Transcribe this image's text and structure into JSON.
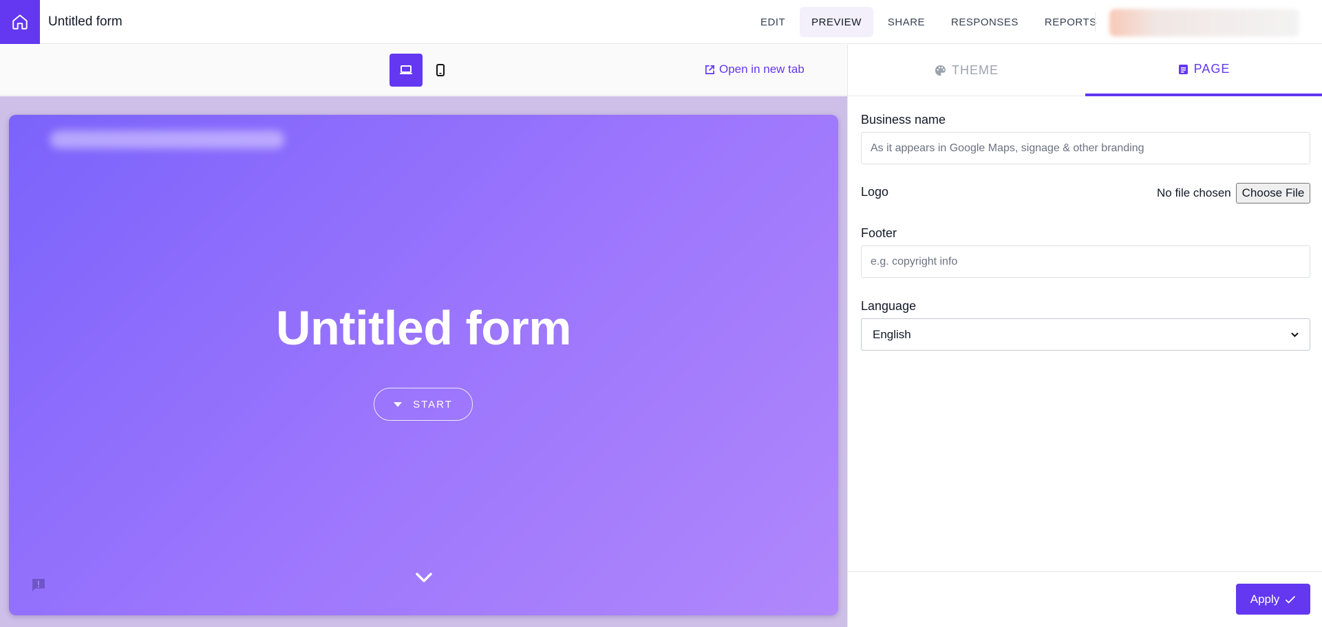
{
  "app": {
    "form_title": "Untitled form"
  },
  "nav": {
    "items": [
      {
        "label": "EDIT"
      },
      {
        "label": "PREVIEW",
        "active": true
      },
      {
        "label": "SHARE"
      },
      {
        "label": "RESPONSES"
      },
      {
        "label": "REPORTS"
      }
    ]
  },
  "preview_toolbar": {
    "devices": [
      "laptop-icon",
      "phone-icon"
    ],
    "selected_device": "laptop",
    "open_new_tab_label": "Open in new tab"
  },
  "preview": {
    "hero_title": "Untitled form",
    "start_label": "START"
  },
  "panel": {
    "tabs": [
      {
        "label": "THEME",
        "icon": "palette-icon"
      },
      {
        "label": "PAGE",
        "icon": "page-icon",
        "active": true
      }
    ],
    "business_name": {
      "label": "Business name",
      "placeholder": "As it appears in Google Maps, signage & other branding",
      "value": ""
    },
    "logo": {
      "label": "Logo",
      "status": "No file chosen",
      "button_label": "Choose File"
    },
    "footer": {
      "label": "Footer",
      "placeholder": "e.g. copyright info",
      "value": ""
    },
    "language": {
      "label": "Language",
      "selected": "English"
    },
    "apply_label": "Apply"
  },
  "colors": {
    "accent": "#6338f0",
    "preview_gradient_start": "#7b63fb",
    "preview_gradient_end": "#b087fb",
    "preview_backdrop": "#cdbfe7"
  }
}
